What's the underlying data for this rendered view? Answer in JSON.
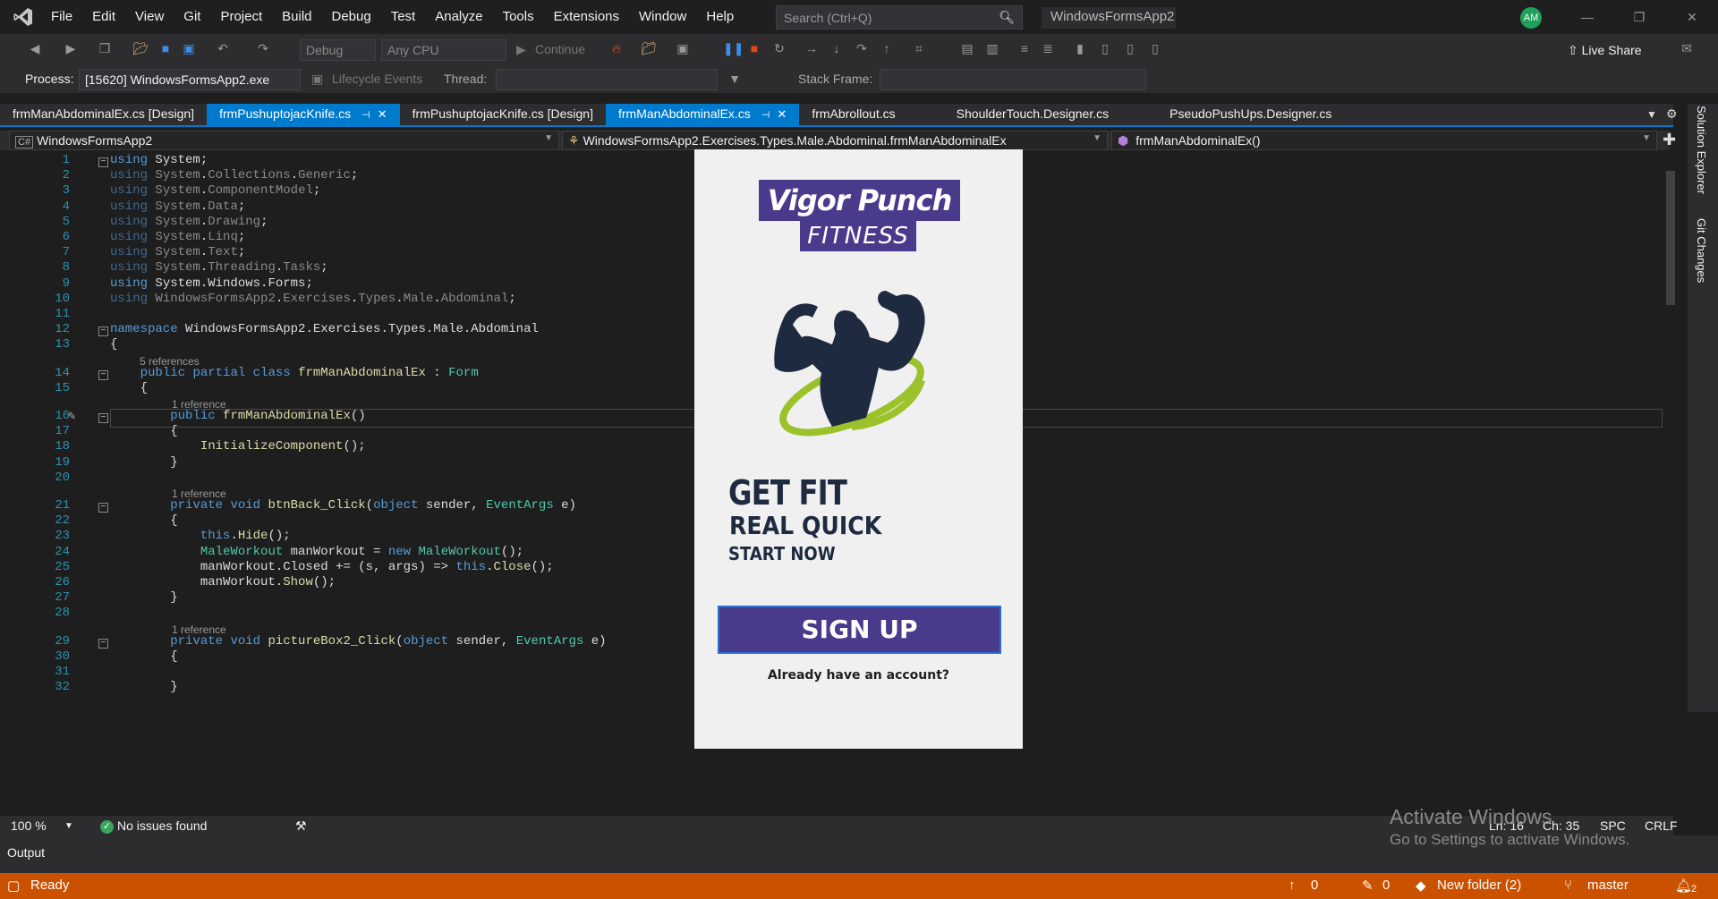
{
  "menu": [
    "File",
    "Edit",
    "View",
    "Git",
    "Project",
    "Build",
    "Debug",
    "Test",
    "Analyze",
    "Tools",
    "Extensions",
    "Window",
    "Help"
  ],
  "search": {
    "placeholder": "Search (Ctrl+Q)"
  },
  "solution_name": "WindowsFormsApp2",
  "user_initials": "AM",
  "toolbar": {
    "config": "Debug",
    "platform": "Any CPU",
    "continue_label": "Continue",
    "live_share": "Live Share"
  },
  "debug_bar": {
    "process_label": "Process:",
    "process_value": "[15620] WindowsFormsApp2.exe",
    "lifecycle_label": "Lifecycle Events",
    "thread_label": "Thread:",
    "stack_frame_label": "Stack Frame:"
  },
  "tabs": [
    {
      "label": "frmManAbdominalEx.cs [Design]",
      "state": "inactive"
    },
    {
      "label": "frmPushuptojacKnife.cs",
      "state": "active-pinned"
    },
    {
      "label": "frmPushuptojacKnife.cs [Design]",
      "state": "inactive"
    },
    {
      "label": "frmManAbdominalEx.cs",
      "state": "active"
    },
    {
      "label": "frmAbrollout.cs",
      "state": "inactive"
    },
    {
      "label": "ShoulderTouch.Designer.cs",
      "state": "inactive"
    },
    {
      "label": "PseudoPushUps.Designer.cs",
      "state": "inactive"
    }
  ],
  "nav": {
    "project": "WindowsFormsApp2",
    "type": "WindowsFormsApp2.Exercises.Types.Male.Abdominal.frmManAbdominalEx",
    "member": "frmManAbdominalEx()"
  },
  "code_lines": [
    {
      "n": "1",
      "text": "using System;"
    },
    {
      "n": "2",
      "text": "using System.Collections.Generic;"
    },
    {
      "n": "3",
      "text": "using System.ComponentModel;"
    },
    {
      "n": "4",
      "text": "using System.Data;"
    },
    {
      "n": "5",
      "text": "using System.Drawing;"
    },
    {
      "n": "6",
      "text": "using System.Linq;"
    },
    {
      "n": "7",
      "text": "using System.Text;"
    },
    {
      "n": "8",
      "text": "using System.Threading.Tasks;"
    },
    {
      "n": "9",
      "text": "using System.Windows.Forms;"
    },
    {
      "n": "10",
      "text": "using WindowsFormsApp2.Exercises.Types.Male.Abdominal;"
    },
    {
      "n": "11",
      "text": ""
    },
    {
      "n": "12",
      "text": "namespace WindowsFormsApp2.Exercises.Types.Male.Abdominal"
    },
    {
      "n": "13",
      "text": "{"
    },
    {
      "n": "14",
      "text": "    public partial class frmManAbdominalEx : Form"
    },
    {
      "n": "15",
      "text": "    {"
    },
    {
      "n": "16",
      "text": "        public frmManAbdominalEx()"
    },
    {
      "n": "17",
      "text": "        {"
    },
    {
      "n": "18",
      "text": "            InitializeComponent();"
    },
    {
      "n": "19",
      "text": "        }"
    },
    {
      "n": "20",
      "text": ""
    },
    {
      "n": "21",
      "text": "        private void btnBack_Click(object sender, EventArgs e)"
    },
    {
      "n": "22",
      "text": "        {"
    },
    {
      "n": "23",
      "text": "            this.Hide();"
    },
    {
      "n": "24",
      "text": "            MaleWorkout manWorkout = new MaleWorkout();"
    },
    {
      "n": "25",
      "text": "            manWorkout.Closed += (s, args) => this.Close();"
    },
    {
      "n": "26",
      "text": "            manWorkout.Show();"
    },
    {
      "n": "27",
      "text": "        }"
    },
    {
      "n": "28",
      "text": ""
    },
    {
      "n": "29",
      "text": "        private void pictureBox2_Click(object sender, EventArgs e)"
    },
    {
      "n": "30",
      "text": "        {"
    },
    {
      "n": "31",
      "text": ""
    },
    {
      "n": "32",
      "text": "        }"
    }
  ],
  "codelens": {
    "class_refs": "5 references",
    "ctor_refs": "1 reference",
    "back_refs": "1 reference",
    "pic_refs": "1 reference"
  },
  "form_preview": {
    "brand_line1": "Vigor Punch",
    "brand_line2": "FITNESS",
    "tagline1": "GET FIT",
    "tagline2": "REAL QUICK",
    "tagline3": "START NOW",
    "signup_button": "SIGN UP",
    "account_link": "Already have an account?",
    "brand_color": "#4a3a8c"
  },
  "side_panels": [
    "Solution Explorer",
    "Git Changes"
  ],
  "editor_status": {
    "zoom": "100 %",
    "issues": "No issues found",
    "line": "Ln: 16",
    "col": "Ch: 35",
    "spc": "SPC",
    "eol": "CRLF"
  },
  "output_label": "Output",
  "activate": {
    "title": "Activate Windows",
    "subtitle": "Go to Settings to activate Windows."
  },
  "statusbar": {
    "ready": "Ready",
    "up_count": "0",
    "pencil_count": "0",
    "folder": "New folder (2)",
    "branch": "master",
    "notifications": "2",
    "color": "#ca5100"
  }
}
